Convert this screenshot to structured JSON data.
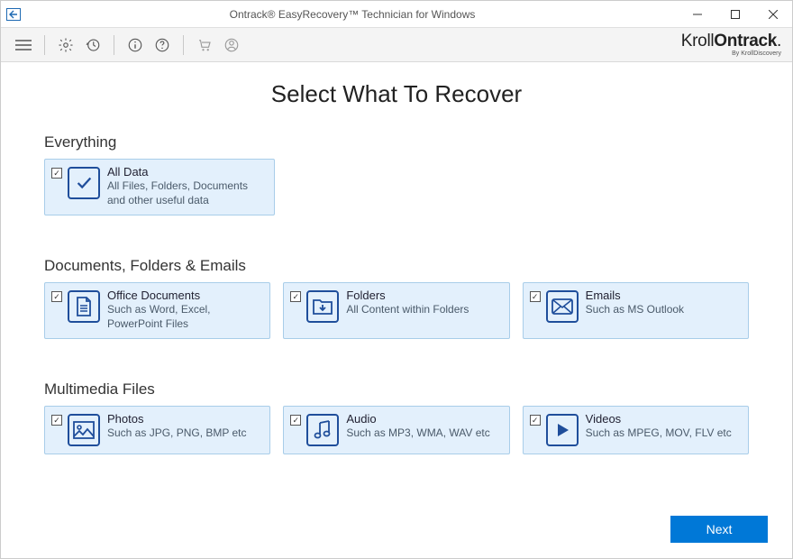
{
  "window": {
    "title": "Ontrack® EasyRecovery™ Technician for Windows"
  },
  "brand": {
    "part1": "Kroll",
    "part2": "Ontrack",
    "sub": "By KrollDiscovery"
  },
  "page": {
    "title": "Select What To Recover"
  },
  "sections": {
    "everything": {
      "heading": "Everything",
      "allData": {
        "title": "All Data",
        "desc": "All Files, Folders, Documents and other useful data"
      }
    },
    "docs": {
      "heading": "Documents, Folders & Emails",
      "office": {
        "title": "Office Documents",
        "desc": "Such as Word, Excel, PowerPoint Files"
      },
      "folders": {
        "title": "Folders",
        "desc": "All Content within Folders"
      },
      "emails": {
        "title": "Emails",
        "desc": "Such as MS Outlook"
      }
    },
    "media": {
      "heading": "Multimedia Files",
      "photos": {
        "title": "Photos",
        "desc": "Such as JPG, PNG, BMP etc"
      },
      "audio": {
        "title": "Audio",
        "desc": "Such as MP3, WMA, WAV etc"
      },
      "videos": {
        "title": "Videos",
        "desc": "Such as MPEG, MOV, FLV etc"
      }
    }
  },
  "footer": {
    "next": "Next"
  }
}
